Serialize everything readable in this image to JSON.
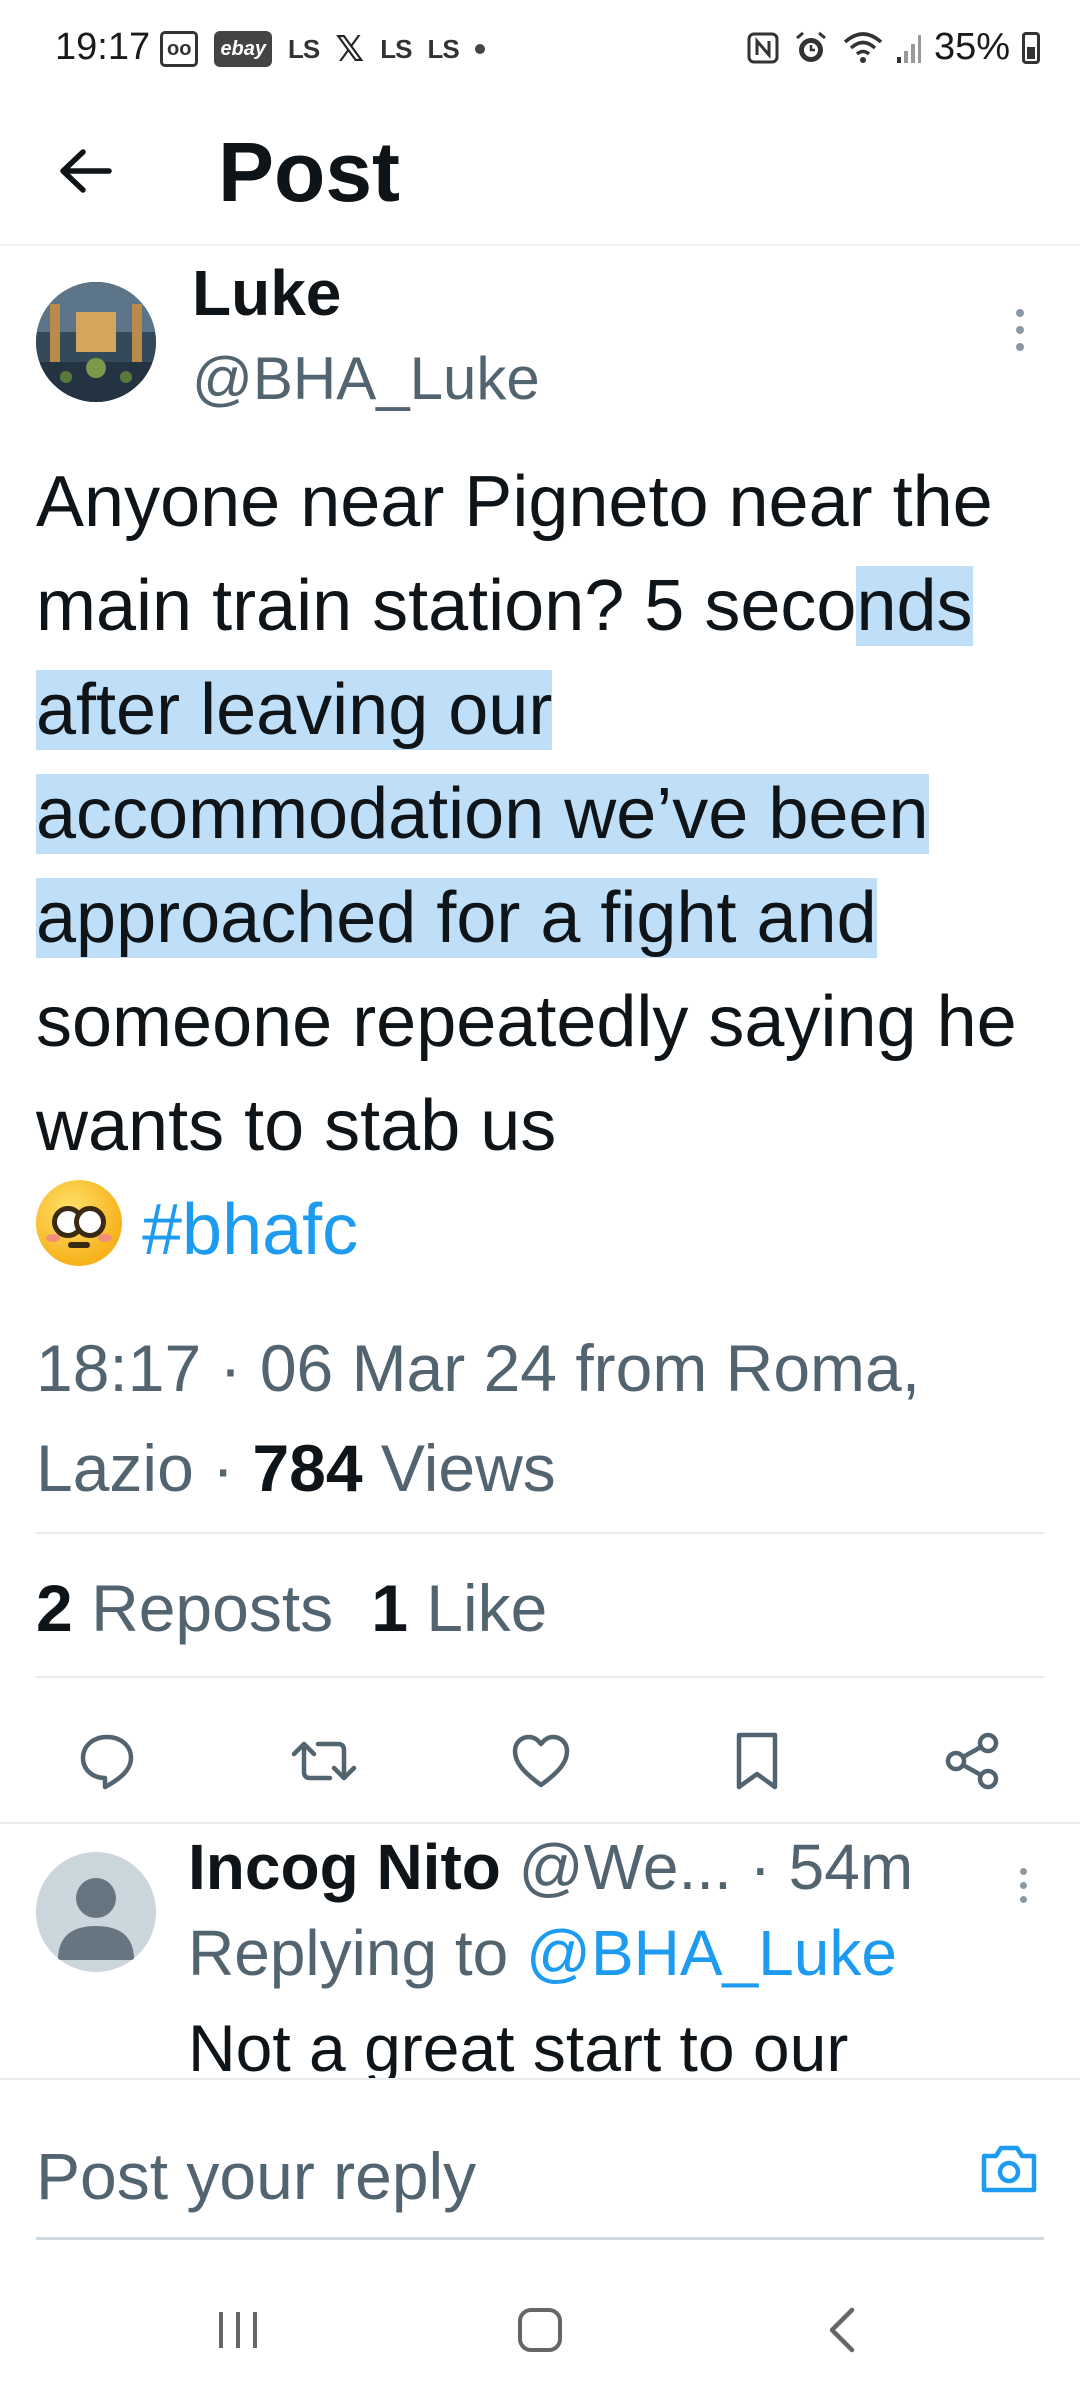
{
  "status_bar": {
    "time": "19:17",
    "left_icons": [
      "voicemail-icon",
      "ebay-icon",
      "ls-icon",
      "x-icon",
      "ls-icon",
      "ls-icon",
      "dot-icon"
    ],
    "ebay_label": "ebay",
    "ls_label": "LS",
    "x_label": "𝕏",
    "battery_percent": "35%",
    "right_icons": [
      "nfc-icon",
      "alarm-icon",
      "wifi-icon",
      "signal-icon",
      "battery-icon"
    ]
  },
  "header": {
    "title": "Post"
  },
  "tweet": {
    "author_name": "Luke",
    "author_handle": "@BHA_Luke",
    "text_before_highlight": "Anyone near Pigneto near the main train station? 5 seco",
    "text_highlighted": "nds after leaving our accommodation we’ve been approached for a fight and",
    "text_after_highlight": " someone repeatedly saying he wants to stab us ",
    "emoji": "flushed-face-emoji",
    "hashtag": "#bhafc",
    "time": "18:17",
    "date": "06 Mar 24",
    "location_prefix": "from Roma,",
    "location_suffix": "Lazio",
    "views_count": "784",
    "views_label": "Views",
    "reposts_count": "2",
    "reposts_label": "Reposts",
    "likes_count": "1",
    "likes_label": "Like"
  },
  "actions": [
    "reply-icon",
    "repost-icon",
    "like-icon",
    "bookmark-icon",
    "share-icon"
  ],
  "reply": {
    "author_name": "Incog Nito",
    "author_handle": "@We...",
    "age": "54m",
    "replying_label": "Replying to",
    "replying_to": "@BHA_Luke",
    "text": "Not a great start to our"
  },
  "composer": {
    "placeholder": "Post your reply"
  },
  "nav": [
    "recents-icon",
    "home-icon",
    "back-icon"
  ],
  "colors": {
    "accent": "#1d9bf0",
    "secondary_text": "#536471",
    "highlight": "#bfdff8"
  }
}
